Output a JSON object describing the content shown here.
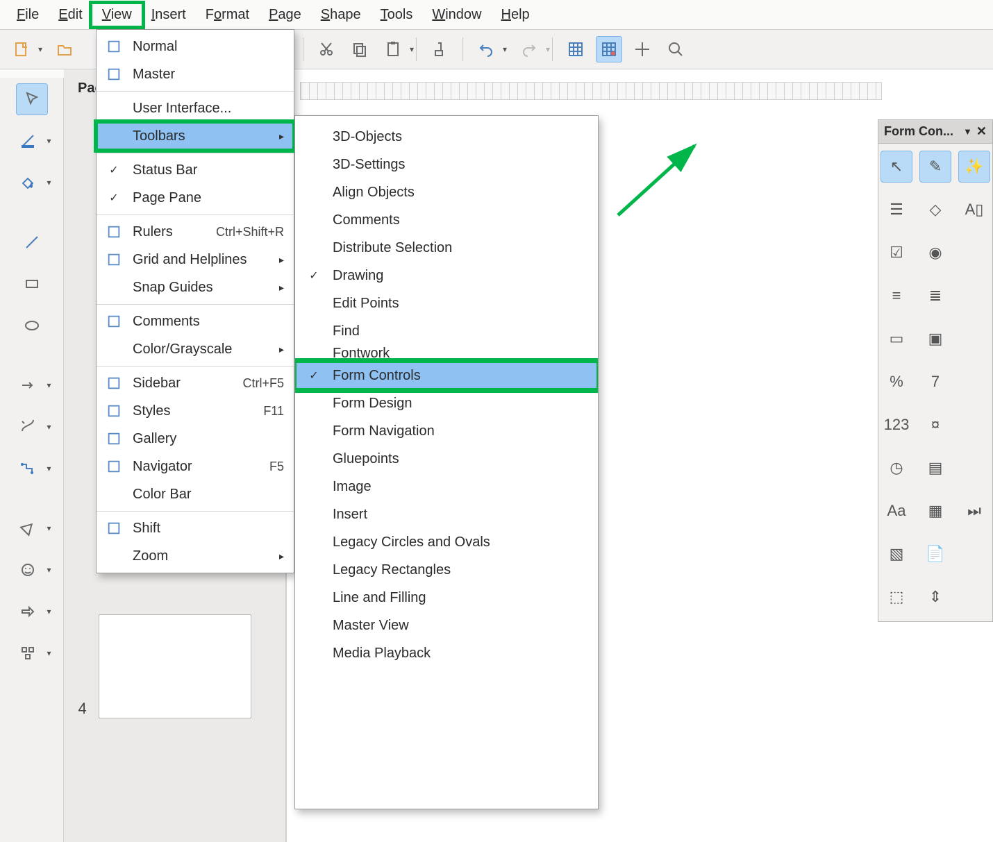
{
  "menubar": {
    "items": [
      {
        "label": "File",
        "ukey": "F"
      },
      {
        "label": "Edit",
        "ukey": "E"
      },
      {
        "label": "View",
        "ukey": "V",
        "marked": true
      },
      {
        "label": "Insert",
        "ukey": "I"
      },
      {
        "label": "Format",
        "ukey": "o"
      },
      {
        "label": "Page",
        "ukey": "P"
      },
      {
        "label": "Shape",
        "ukey": "S"
      },
      {
        "label": "Tools",
        "ukey": "T"
      },
      {
        "label": "Window",
        "ukey": "W"
      },
      {
        "label": "Help",
        "ukey": "H"
      }
    ]
  },
  "page_pane": {
    "title": "Pag",
    "thumb_number": "4"
  },
  "view_menu": {
    "items": [
      {
        "icon": "normal-view-icon",
        "label": "Normal",
        "type": "item"
      },
      {
        "icon": "master-view-icon",
        "label": "Master",
        "type": "item"
      },
      {
        "type": "sep"
      },
      {
        "label": "User Interface...",
        "type": "item"
      },
      {
        "label": "Toolbars",
        "type": "submenu",
        "marked": true,
        "selected": true
      },
      {
        "type": "sep"
      },
      {
        "check": true,
        "label": "Status Bar",
        "type": "item"
      },
      {
        "check": true,
        "label": "Page Pane",
        "type": "item"
      },
      {
        "type": "sep"
      },
      {
        "icon": "rulers-icon",
        "label": "Rulers",
        "accel": "Ctrl+Shift+R",
        "type": "item"
      },
      {
        "icon": "grid-icon",
        "label": "Grid and Helplines",
        "type": "submenu"
      },
      {
        "label": "Snap Guides",
        "type": "submenu"
      },
      {
        "type": "sep"
      },
      {
        "icon": "comments-icon",
        "label": "Comments",
        "type": "item"
      },
      {
        "label": "Color/Grayscale",
        "type": "submenu"
      },
      {
        "type": "sep"
      },
      {
        "icon": "sidebar-icon",
        "label": "Sidebar",
        "accel": "Ctrl+F5",
        "type": "item"
      },
      {
        "icon": "styles-icon",
        "label": "Styles",
        "accel": "F11",
        "type": "item"
      },
      {
        "icon": "gallery-icon",
        "label": "Gallery",
        "type": "item"
      },
      {
        "icon": "navigator-icon",
        "label": "Navigator",
        "accel": "F5",
        "type": "item"
      },
      {
        "label": "Color Bar",
        "type": "item"
      },
      {
        "type": "sep"
      },
      {
        "icon": "shift-icon",
        "label": "Shift",
        "type": "item"
      },
      {
        "label": "Zoom",
        "type": "submenu"
      }
    ]
  },
  "toolbars_submenu": {
    "items": [
      {
        "label": "3D-Objects"
      },
      {
        "label": "3D-Settings"
      },
      {
        "label": "Align Objects"
      },
      {
        "label": "Comments"
      },
      {
        "label": "Distribute Selection"
      },
      {
        "check": true,
        "label": "Drawing"
      },
      {
        "label": "Edit Points"
      },
      {
        "label": "Find"
      },
      {
        "label": "Fontwork",
        "cutoff": true
      },
      {
        "check": true,
        "label": "Form Controls",
        "selected": true,
        "marked": true
      },
      {
        "label": "Form Design"
      },
      {
        "label": "Form Navigation"
      },
      {
        "label": "Gluepoints"
      },
      {
        "label": "Image"
      },
      {
        "label": "Insert"
      },
      {
        "label": "Legacy Circles and Ovals"
      },
      {
        "label": "Legacy Rectangles"
      },
      {
        "label": "Line and Filling"
      },
      {
        "label": "Master View"
      },
      {
        "label": "Media Playback"
      }
    ]
  },
  "form_panel": {
    "title": "Form Con...",
    "icons": [
      {
        "name": "select-icon",
        "selected": true,
        "glyph": "↖"
      },
      {
        "name": "design-mode-icon",
        "selected": true,
        "glyph": "✎"
      },
      {
        "name": "wizard-icon",
        "selected": true,
        "glyph": "✨"
      },
      {
        "name": "listbox-icon",
        "glyph": "☰"
      },
      {
        "name": "label-icon",
        "glyph": "◇"
      },
      {
        "name": "textbox-icon",
        "glyph": "A▯"
      },
      {
        "name": "checkbox-icon",
        "glyph": "☑"
      },
      {
        "name": "radio-icon",
        "glyph": "◉"
      },
      {
        "name": "",
        "glyph": ""
      },
      {
        "name": "combo-icon",
        "glyph": "≡"
      },
      {
        "name": "listctl-icon",
        "glyph": "≣"
      },
      {
        "name": "",
        "glyph": ""
      },
      {
        "name": "push-button-icon",
        "glyph": "▭"
      },
      {
        "name": "image-button-icon",
        "glyph": "▣"
      },
      {
        "name": "",
        "glyph": ""
      },
      {
        "name": "formatted-icon",
        "glyph": "%"
      },
      {
        "name": "date-icon",
        "glyph": "7"
      },
      {
        "name": "",
        "glyph": ""
      },
      {
        "name": "numeric-icon",
        "glyph": "123"
      },
      {
        "name": "currency-icon",
        "glyph": "¤"
      },
      {
        "name": "",
        "glyph": ""
      },
      {
        "name": "time-icon",
        "glyph": "◷"
      },
      {
        "name": "pattern-icon",
        "glyph": "▤"
      },
      {
        "name": "",
        "glyph": ""
      },
      {
        "name": "font-icon",
        "glyph": "Aa"
      },
      {
        "name": "table-ctl-icon",
        "glyph": "▦"
      },
      {
        "name": "nav-icon",
        "glyph": "⏭"
      },
      {
        "name": "image-ctl-icon",
        "glyph": "▧"
      },
      {
        "name": "file-sel-icon",
        "glyph": "📄"
      },
      {
        "name": "",
        "glyph": ""
      },
      {
        "name": "group-icon",
        "glyph": "⬚"
      },
      {
        "name": "spin-icon",
        "glyph": "⇕"
      }
    ]
  }
}
